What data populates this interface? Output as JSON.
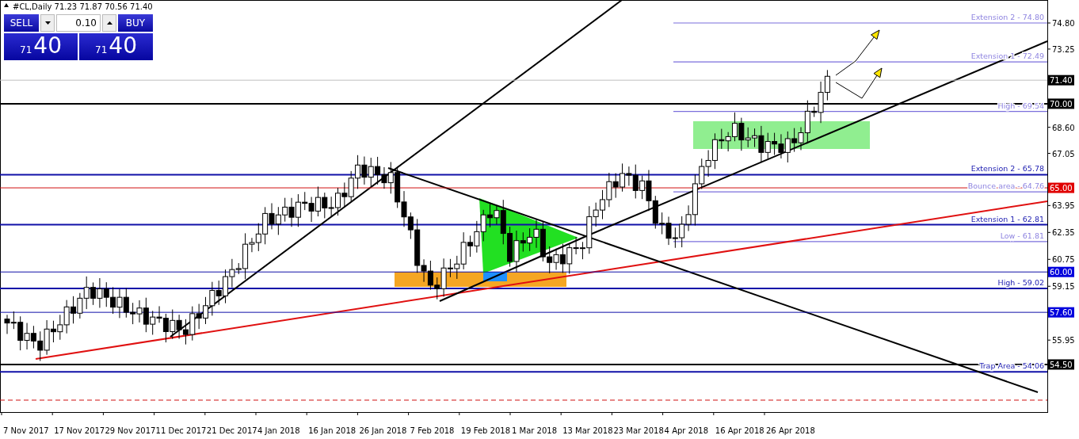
{
  "header": {
    "symbol": "#CL,Daily",
    "ohlc": "71.23 71.87 70.56 71.40"
  },
  "trade_panel": {
    "sell": "SELL",
    "buy": "BUY",
    "lot": "0.10",
    "bid": {
      "small": "71",
      "large": "40"
    },
    "ask": {
      "small": "71",
      "large": "40"
    }
  },
  "levels": [
    {
      "kind": "target",
      "label": "Extension 2 - 74.80"
    },
    {
      "kind": "target",
      "label": "Extension 1 - 72.49"
    },
    {
      "kind": "target",
      "label": "High - 69.54"
    },
    {
      "kind": "major",
      "label": "Extension 2 - 65.78"
    },
    {
      "kind": "target",
      "label": "Bounce area - 64.76"
    },
    {
      "kind": "major",
      "label": "Extension 1 - 62.81"
    },
    {
      "kind": "target",
      "label": "Low - 61.81"
    },
    {
      "kind": "major",
      "label": "High - 59.02"
    },
    {
      "kind": "major",
      "label": "Trap Area - 54.06"
    },
    {
      "kind": "stop"
    }
  ],
  "price_badges": [
    {
      "kind": "price",
      "text": "71.40"
    },
    {
      "kind": "key",
      "text": "70.00"
    },
    {
      "kind": "pivot",
      "text": "65.00"
    },
    {
      "kind": "minor",
      "text": "60.00"
    },
    {
      "kind": "minor",
      "text": "57.60"
    },
    {
      "kind": "key",
      "text": "54.50"
    }
  ],
  "y_axis": [
    "74.80",
    "73.25",
    "68.60",
    "67.05",
    "63.95",
    "62.35",
    "60.75",
    "59.15",
    "55.95"
  ],
  "x_axis": [
    "7 Nov 2017",
    "17 Nov 2017",
    "29 Nov 2017",
    "11 Dec 2017",
    "21 Dec 2017",
    "4 Jan 2018",
    "16 Jan 2018",
    "26 Jan 2018",
    "7 Feb 2018",
    "19 Feb 2018",
    "1 Mar 2018",
    "13 Mar 2018",
    "23 Mar 2018",
    "4 Apr 2018",
    "16 Apr 2018",
    "26 Apr 2018"
  ]
}
